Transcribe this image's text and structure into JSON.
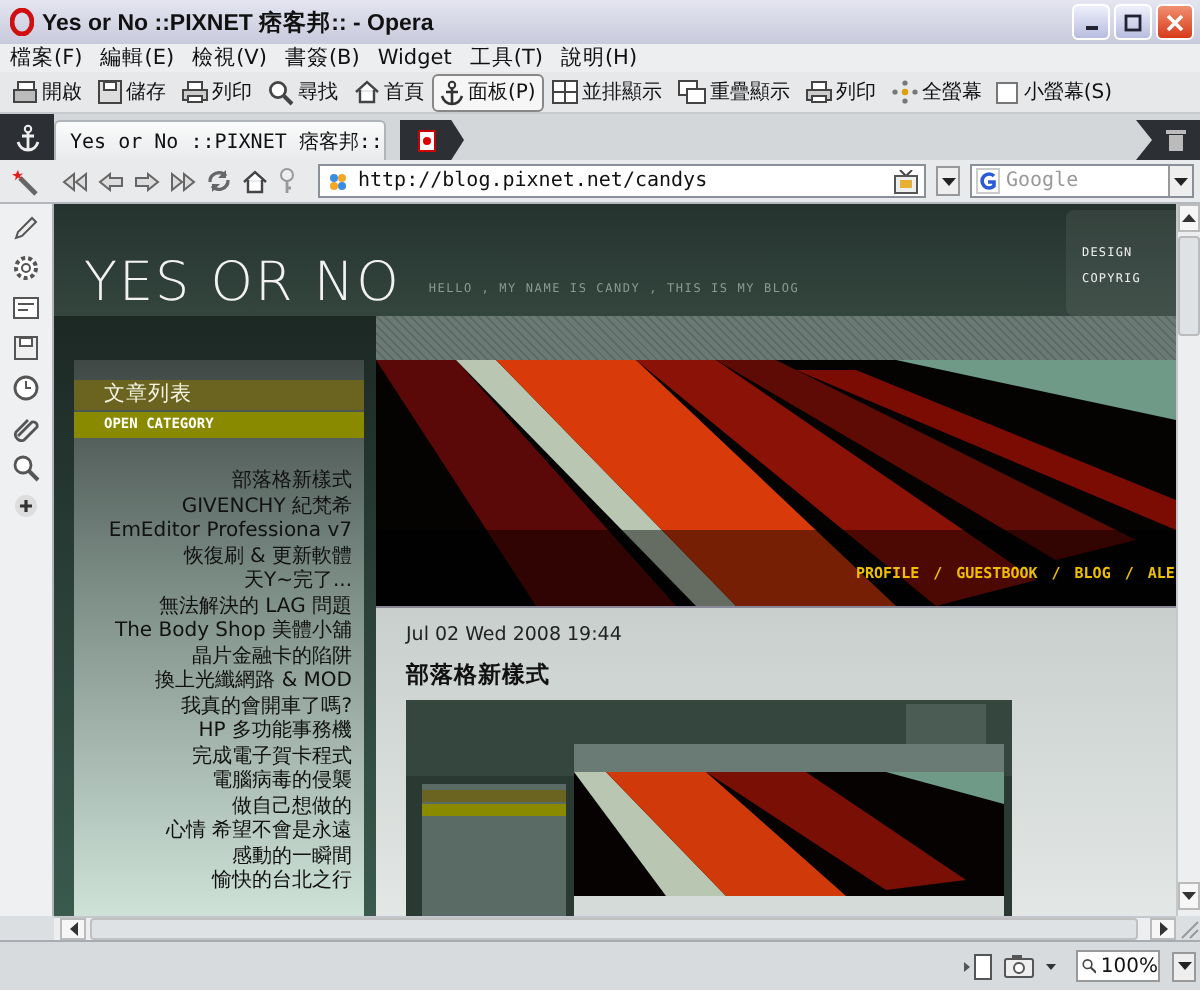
{
  "window": {
    "title": "Yes or No ::PIXNET 痞客邦:: - Opera"
  },
  "menu": [
    "檔案(F)",
    "編輯(E)",
    "檢視(V)",
    "書簽(B)",
    "Widget",
    "工具(T)",
    "說明(H)"
  ],
  "toolbar": [
    {
      "kind": "button",
      "label": "開啟",
      "pressed": false
    },
    {
      "kind": "button",
      "label": "儲存",
      "pressed": false
    },
    {
      "kind": "button",
      "label": "列印",
      "pressed": false
    },
    {
      "kind": "button",
      "label": "尋找",
      "pressed": false
    },
    {
      "kind": "button",
      "label": "首頁",
      "pressed": false
    },
    {
      "kind": "button",
      "label": "面板(P)",
      "pressed": true
    },
    {
      "kind": "button",
      "label": "並排顯示",
      "pressed": false
    },
    {
      "kind": "button",
      "label": "重疊顯示",
      "pressed": false
    },
    {
      "kind": "button",
      "label": "列印",
      "pressed": false
    },
    {
      "kind": "button",
      "label": "全螢幕",
      "pressed": false
    },
    {
      "kind": "checkbox",
      "label": "小螢幕(S)",
      "checked": false
    }
  ],
  "tabs": [
    {
      "title": "Yes or No ::PIXNET 痞客邦::",
      "selected": true
    }
  ],
  "address": {
    "url": "http://blog.pixnet.net/candys"
  },
  "search": {
    "placeholder": "Google"
  },
  "page": {
    "header": {
      "logo": "YES OR NO",
      "tagline": "HELLO , MY NAME IS CANDY , THIS IS MY BLOG",
      "credits": [
        "DESIGN",
        "COPYRIG"
      ]
    },
    "sidebar": {
      "title": "文章列表",
      "category": "OPEN CATEGORY",
      "articles": [
        "部落格新樣式",
        "GIVENCHY 紀梵希",
        "EmEditor Professiona v7",
        "恢復刷 & 更新軟體",
        "天Y~完了...",
        "無法解決的 LAG 問題",
        "The Body Shop 美體小舖",
        "晶片金融卡的陷阱",
        "換上光纖網路 & MOD",
        "我真的會開車了嗎?",
        "HP 多功能事務機",
        "完成電子賀卡程式",
        "電腦病毒的侵襲",
        "做自己想做的",
        "心情 希望不會是永遠",
        "感動的一瞬間",
        "愉快的台北之行"
      ]
    },
    "nav": {
      "separator": "/",
      "links": [
        "PROFILE",
        "GUESTBOOK",
        "BLOG",
        "ALE"
      ]
    },
    "post": {
      "date": "Jul 02 Wed 2008 19:44",
      "title": "部落格新樣式"
    }
  },
  "status": {
    "zoom": "100%"
  }
}
